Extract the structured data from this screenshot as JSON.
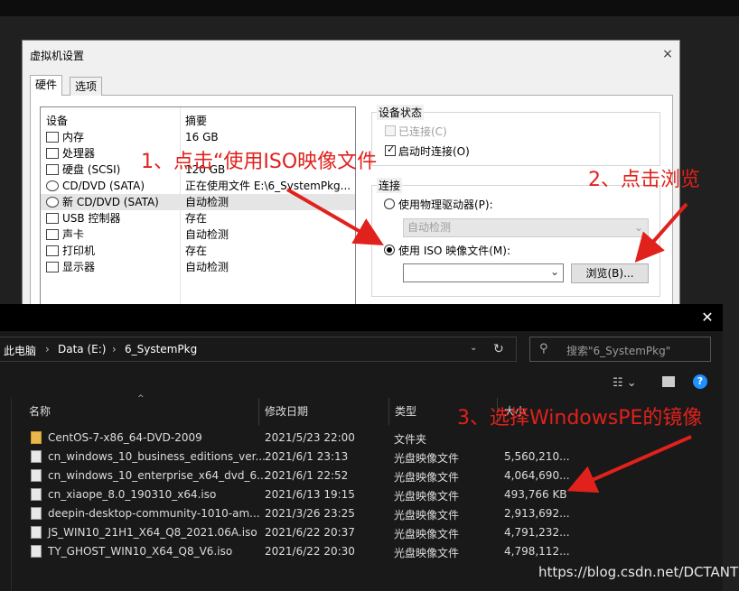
{
  "vm_dialog": {
    "title": "虚拟机设置",
    "close": "×",
    "tabs": [
      "硬件",
      "选项"
    ],
    "columns": {
      "device": "设备",
      "summary": "摘要"
    },
    "devices": [
      {
        "name": "内存",
        "summary": "16 GB",
        "icon": "memory-icon"
      },
      {
        "name": "处理器",
        "summary": "",
        "icon": "cpu-icon"
      },
      {
        "name": "硬盘 (SCSI)",
        "summary": "120 GB",
        "icon": "harddisk-icon"
      },
      {
        "name": "CD/DVD (SATA)",
        "summary": "正在使用文件 E:\\6_SystemPkg...",
        "icon": "cdrom-icon"
      },
      {
        "name": "新 CD/DVD (SATA)",
        "summary": "自动检测",
        "icon": "cdrom-icon"
      },
      {
        "name": "USB 控制器",
        "summary": "存在",
        "icon": "usb-icon"
      },
      {
        "name": "声卡",
        "summary": "自动检测",
        "icon": "speaker-icon"
      },
      {
        "name": "打印机",
        "summary": "存在",
        "icon": "printer-icon"
      },
      {
        "name": "显示器",
        "summary": "自动检测",
        "icon": "monitor-icon"
      }
    ],
    "device_status": {
      "title": "设备状态",
      "connected": "已连接(C)",
      "connect_on_power": "启动时连接(O)"
    },
    "connection": {
      "title": "连接",
      "physical_drive": "使用物理驱动器(P):",
      "physical_value": "自动检测",
      "iso_file": "使用 ISO 映像文件(M):",
      "iso_path": "",
      "browse_button": "浏览(B)..."
    }
  },
  "explorer": {
    "close": "✕",
    "breadcrumb": [
      "此电脑",
      "Data (E:)",
      "6_SystemPkg"
    ],
    "search_placeholder": "搜索\"6_SystemPkg\"",
    "columns": {
      "name": "名称",
      "date": "修改日期",
      "type": "类型",
      "size": "大小"
    },
    "files": [
      {
        "name": "CentOS-7-x86_64-DVD-2009",
        "date": "2021/5/23 22:00",
        "type": "文件夹",
        "size": "",
        "kind": "folder"
      },
      {
        "name": "cn_windows_10_business_editions_ver...",
        "date": "2021/6/1 23:13",
        "type": "光盘映像文件",
        "size": "5,560,210...",
        "kind": "disc"
      },
      {
        "name": "cn_windows_10_enterprise_x64_dvd_6...",
        "date": "2021/6/1 22:52",
        "type": "光盘映像文件",
        "size": "4,064,690...",
        "kind": "disc"
      },
      {
        "name": "cn_xiaope_8.0_190310_x64.iso",
        "date": "2021/6/13 19:15",
        "type": "光盘映像文件",
        "size": "493,766 KB",
        "kind": "disc"
      },
      {
        "name": "deepin-desktop-community-1010-am...",
        "date": "2021/3/26 23:25",
        "type": "光盘映像文件",
        "size": "2,913,692...",
        "kind": "disc"
      },
      {
        "name": "JS_WIN10_21H1_X64_Q8_2021.06A.iso",
        "date": "2021/6/22 20:37",
        "type": "光盘映像文件",
        "size": "4,791,232...",
        "kind": "disc"
      },
      {
        "name": "TY_GHOST_WIN10_X64_Q8_V6.iso",
        "date": "2021/6/22 20:30",
        "type": "光盘映像文件",
        "size": "4,798,112...",
        "kind": "disc"
      }
    ]
  },
  "annotations": {
    "step1": "1、点击“使用ISO映像文件",
    "step2": "2、点击浏览",
    "step3": "3、选择WindowsPE的镜像",
    "color": "#e0211c"
  },
  "watermark": "https://blog.csdn.net/DCTANT"
}
